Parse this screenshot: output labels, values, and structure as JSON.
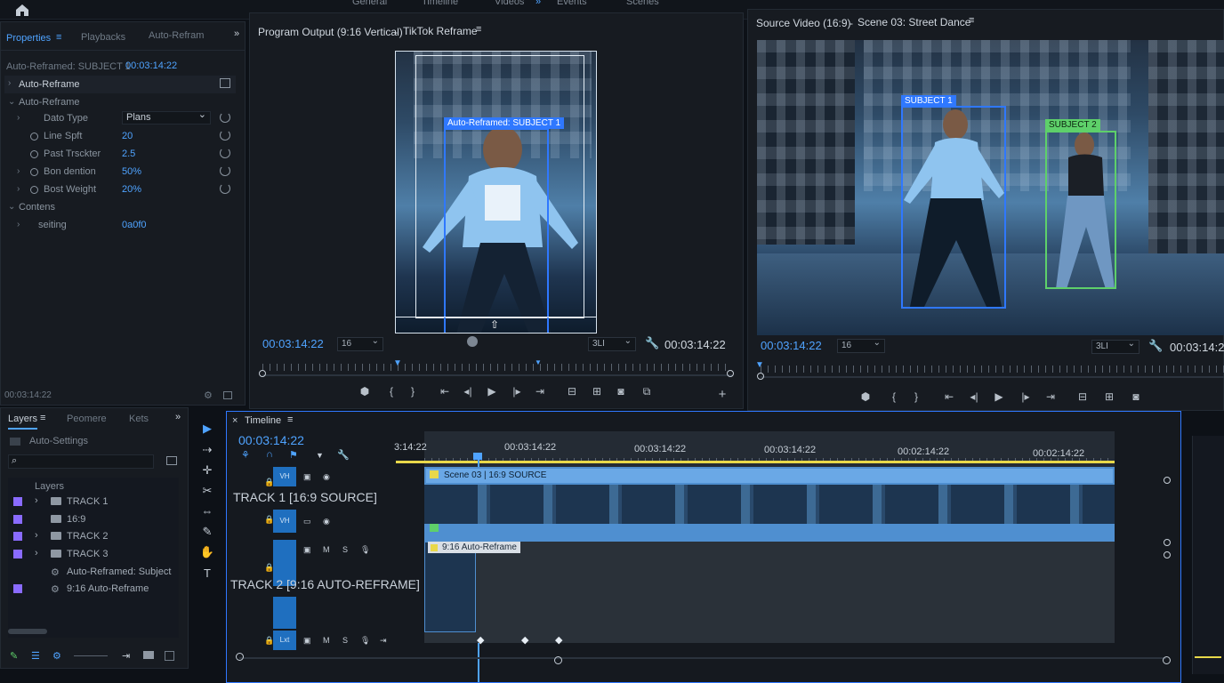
{
  "top_menu": [
    "General",
    "Timeline",
    "Videos",
    "Events",
    "Scenes"
  ],
  "properties_panel": {
    "tabs": [
      "Properties",
      "Playbacks",
      "Auto-Refram"
    ],
    "clip_name": "Auto-Reframed: SUBJECT 1",
    "clip_time": "00:03:14:22",
    "section_title": "Auto-Reframe",
    "group_title": "Auto-Reframe",
    "rows": [
      {
        "label": "Dato Type",
        "value": "Plans"
      },
      {
        "label": "Line Spft",
        "value": "20"
      },
      {
        "label": "Past Trsckter",
        "value": "2.5"
      },
      {
        "label": "Bon dention",
        "value": "50%"
      },
      {
        "label": "Bost Weight",
        "value": "20%"
      }
    ],
    "contents_title": "Contens",
    "contents_row": {
      "label": "seiting",
      "value": "0a0f0"
    },
    "footer_time": "00:03:14:22"
  },
  "program_monitor": {
    "title": "Program Output (9:16 Vertical)",
    "sequence": "TikTok Reframe",
    "overlay_label": "Auto-Reframed: SUBJECT 1",
    "time_left": "00:03:14:22",
    "zoom": "16",
    "quality": "3LI",
    "time_right": "00:03:14:22"
  },
  "source_monitor": {
    "title": "Source Video (16:9)",
    "clip": "Scene 03: Street Dance",
    "subject1_label": "SUBJECT 1",
    "subject2_label": "SUBJECT 2",
    "time_left": "00:03:14:22",
    "zoom": "16",
    "quality": "3LI",
    "time_right": "00:03:14:22"
  },
  "layers_panel": {
    "tabs": [
      "Layers",
      "Peomere",
      "Kets"
    ],
    "auto_settings": "Auto-Settings",
    "search_placeholder": "",
    "header": "Layers",
    "items": [
      {
        "label": "TRACK 1",
        "has_caret": true,
        "icon": "folder-icon"
      },
      {
        "label": "16:9",
        "has_caret": false,
        "icon": "folder-icon"
      },
      {
        "label": "TRACK 2",
        "has_caret": true,
        "icon": "folder-icon"
      },
      {
        "label": "TRACK 3",
        "has_caret": true,
        "icon": "folder-icon"
      },
      {
        "label": "Auto-Reframed: Subject",
        "has_caret": false,
        "icon": "effect-icon"
      },
      {
        "label": "9:16 Auto-Reframe",
        "has_caret": false,
        "icon": "effect-icon"
      }
    ]
  },
  "timeline": {
    "title": "Timeline",
    "current_time": "00:03:14:22",
    "ruler_labels": [
      "3:14:22",
      "00:03:14:22",
      "00:03:14:22",
      "00:03:14:22",
      "00:02:14:22",
      "00:02:14:22"
    ],
    "track1_label": "TRACK 1 [16:9 SOURCE]",
    "track2_label": "TRACK 2 [9:16 AUTO-REFRAME]",
    "track1_clip": "Scene 03 | 16:9 SOURCE",
    "track2_clip": "9:16 Auto-Reframe",
    "v_label_1": "VH",
    "v_label_2": "VH",
    "v_label_3": "Lxt"
  },
  "colors": {
    "accent": "#4fa3ff",
    "subject1_box": "#2f78ff",
    "subject2_box": "#5ed06a",
    "track_clip": "#4f8fd0",
    "layer_swatch": "#8a6bff"
  }
}
